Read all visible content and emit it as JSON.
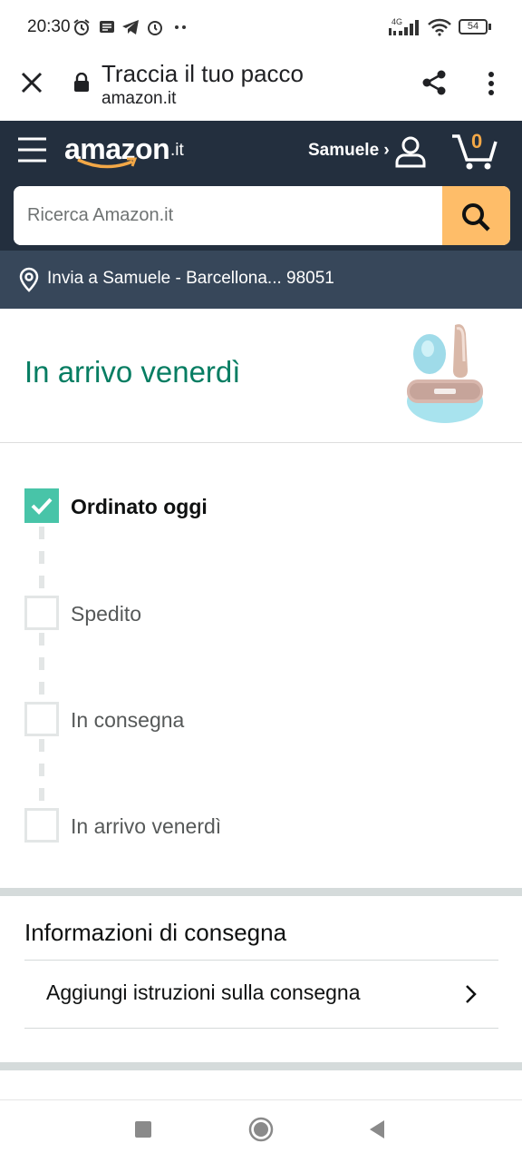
{
  "status_bar": {
    "time": "20:30",
    "network": "4G",
    "battery": "54",
    "icons": [
      "alarm-clock-icon",
      "message-icon",
      "telegram-icon",
      "alarm-icon",
      "more-dots-icon",
      "signal-icon",
      "wifi-icon",
      "battery-icon"
    ]
  },
  "browser": {
    "page_title": "Traccia il tuo pacco",
    "url": "amazon.it",
    "icons": [
      "close-icon",
      "lock-icon",
      "share-icon",
      "overflow-menu-icon"
    ]
  },
  "header": {
    "logo": "amazon",
    "logo_tld": ".it",
    "user_label": "Samuele ›",
    "cart_count": "0",
    "search_placeholder": "Ricerca Amazon.it"
  },
  "location": {
    "text": "Invia a Samuele - Barcellona... 98051"
  },
  "arrival": {
    "title": "In arrivo venerdì"
  },
  "steps": [
    {
      "label": "Ordinato oggi",
      "done": true
    },
    {
      "label": "Spedito",
      "done": false
    },
    {
      "label": "In consegna",
      "done": false
    },
    {
      "label": "In arrivo venerdì",
      "done": false
    }
  ],
  "delivery": {
    "heading": "Informazioni di consegna",
    "action_label": "Aggiungi istruzioni sulla consegna"
  },
  "colors": {
    "header_bg": "#232f3e",
    "location_bg": "#37475a",
    "search_button": "#febd69",
    "accent_green": "#067d62",
    "check_teal": "#48c4a8",
    "cart_orange": "#f3a847"
  }
}
